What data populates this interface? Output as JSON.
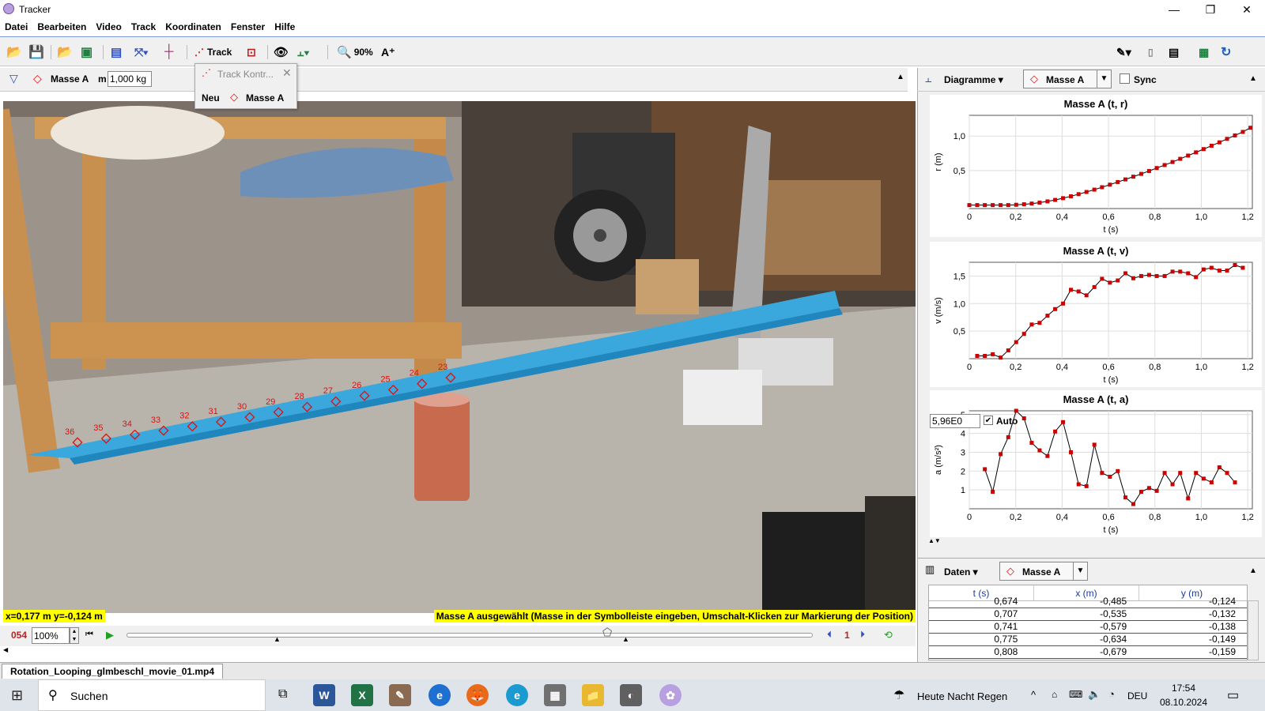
{
  "app": {
    "title": "Tracker"
  },
  "menu": [
    "Datei",
    "Bearbeiten",
    "Video",
    "Track",
    "Koordinaten",
    "Fenster",
    "Hilfe"
  ],
  "toolbar": {
    "track_label": "Track",
    "zoom": "90%"
  },
  "trackbar": {
    "track_name": "Masse A",
    "mass_label": "m",
    "mass_value": "1,000 kg"
  },
  "track_control": {
    "title": "Track Kontr...",
    "new_label": "Neu",
    "track_name": "Masse A"
  },
  "video": {
    "coord_readout": "x=0,177 m  y=-0,124 m",
    "status_message": "Masse A ausgewählt (Masse in der Symbolleiste eingeben, Umschalt-Klicken zur Markierung der Position)",
    "frame_labels": [
      "23",
      "24",
      "25",
      "26",
      "27",
      "28",
      "29",
      "30",
      "31",
      "32",
      "33",
      "34",
      "35",
      "36"
    ]
  },
  "playback": {
    "frame": "054",
    "speed": "100%",
    "step": "1"
  },
  "file_tab": "Rotation_Looping_glmbeschl_movie_01.mp4",
  "plot_panel": {
    "header_label": "Diagramme",
    "track_name": "Masse A",
    "sync_label": "Sync"
  },
  "chart_data": [
    {
      "type": "scatter",
      "title": "Masse A (t, r)",
      "xlabel": "t (s)",
      "ylabel": "r (m)",
      "xlim": [
        0,
        1.22
      ],
      "ylim": [
        -0.05,
        1.3
      ],
      "xticks": [
        "0",
        "0,2",
        "0,4",
        "0,6",
        "0,8",
        "1,0",
        "1,2"
      ],
      "yticks": [
        "0,5",
        "1,0"
      ],
      "color": "#cc0000",
      "x": [
        0,
        0.034,
        0.067,
        0.101,
        0.135,
        0.168,
        0.202,
        0.236,
        0.269,
        0.303,
        0.337,
        0.37,
        0.404,
        0.438,
        0.471,
        0.505,
        0.539,
        0.572,
        0.606,
        0.64,
        0.673,
        0.707,
        0.741,
        0.775,
        0.808,
        0.842,
        0.876,
        0.909,
        0.943,
        0.977,
        1.01,
        1.044,
        1.078,
        1.111,
        1.145,
        1.179,
        1.212
      ],
      "y": [
        0,
        0,
        0,
        0,
        0,
        0,
        0.005,
        0.012,
        0.022,
        0.036,
        0.054,
        0.075,
        0.1,
        0.128,
        0.158,
        0.19,
        0.224,
        0.259,
        0.296,
        0.334,
        0.372,
        0.412,
        0.452,
        0.494,
        0.537,
        0.58,
        0.624,
        0.67,
        0.717,
        0.764,
        0.811,
        0.86,
        0.909,
        0.959,
        1.009,
        1.06,
        1.12
      ]
    },
    {
      "type": "line",
      "title": "Masse A (t, v)",
      "xlabel": "t (s)",
      "ylabel": "v (m/s)",
      "xlim": [
        0,
        1.22
      ],
      "ylim": [
        0,
        1.75
      ],
      "xticks": [
        "0",
        "0,2",
        "0,4",
        "0,6",
        "0,8",
        "1,0",
        "1,2"
      ],
      "yticks": [
        "0,5",
        "1,0",
        "1,5"
      ],
      "color": "#cc0000",
      "x": [
        0.034,
        0.067,
        0.101,
        0.135,
        0.168,
        0.202,
        0.236,
        0.269,
        0.303,
        0.337,
        0.37,
        0.404,
        0.438,
        0.471,
        0.505,
        0.539,
        0.572,
        0.606,
        0.64,
        0.673,
        0.707,
        0.741,
        0.775,
        0.808,
        0.842,
        0.876,
        0.909,
        0.943,
        0.977,
        1.01,
        1.044,
        1.078,
        1.111,
        1.145,
        1.179
      ],
      "y": [
        0.05,
        0.05,
        0.08,
        0.02,
        0.15,
        0.3,
        0.45,
        0.62,
        0.65,
        0.78,
        0.9,
        1.0,
        1.25,
        1.22,
        1.15,
        1.3,
        1.45,
        1.38,
        1.42,
        1.55,
        1.46,
        1.5,
        1.52,
        1.5,
        1.5,
        1.58,
        1.58,
        1.55,
        1.48,
        1.62,
        1.65,
        1.6,
        1.6,
        1.7,
        1.65
      ]
    },
    {
      "type": "line",
      "title": "Masse A (t, a)",
      "xlabel": "t (s)",
      "ylabel": "a (m/s²)",
      "xlim": [
        0,
        1.22
      ],
      "ylim": [
        0,
        5.2
      ],
      "xticks": [
        "0",
        "0,2",
        "0,4",
        "0,6",
        "0,8",
        "1,0",
        "1,2"
      ],
      "yticks": [
        "1",
        "2",
        "3",
        "4",
        "5"
      ],
      "color": "#cc0000",
      "x": [
        0.067,
        0.101,
        0.135,
        0.168,
        0.202,
        0.236,
        0.269,
        0.303,
        0.337,
        0.37,
        0.404,
        0.438,
        0.471,
        0.505,
        0.539,
        0.572,
        0.606,
        0.64,
        0.673,
        0.707,
        0.741,
        0.775,
        0.808,
        0.842,
        0.876,
        0.909,
        0.943,
        0.977,
        1.01,
        1.044,
        1.078,
        1.111,
        1.145
      ],
      "y": [
        2.1,
        0.9,
        2.9,
        3.8,
        5.3,
        4.8,
        3.5,
        3.1,
        2.8,
        4.1,
        4.6,
        3.0,
        1.3,
        1.2,
        3.4,
        1.9,
        1.7,
        2.0,
        0.6,
        0.25,
        0.9,
        1.1,
        0.95,
        1.9,
        1.3,
        1.9,
        0.55,
        1.9,
        1.6,
        1.4,
        2.2,
        1.9,
        1.4
      ]
    }
  ],
  "accel_field": "5,96E0",
  "auto_label": "Auto",
  "data_panel": {
    "header_label": "Daten",
    "track_name": "Masse A",
    "columns": [
      "t (s)",
      "x (m)",
      "y (m)"
    ],
    "rows": [
      [
        "0,674",
        "-0,485",
        "-0,124"
      ],
      [
        "0,707",
        "-0,535",
        "-0,132"
      ],
      [
        "0,741",
        "-0,579",
        "-0,138"
      ],
      [
        "0,775",
        "-0,634",
        "-0,149"
      ],
      [
        "0,808",
        "-0,679",
        "-0,159"
      ]
    ]
  },
  "taskbar": {
    "search": "Suchen",
    "weather": "Heute Nacht Regen",
    "lang": "DEU",
    "time": "17:54",
    "date": "08.10.2024"
  }
}
